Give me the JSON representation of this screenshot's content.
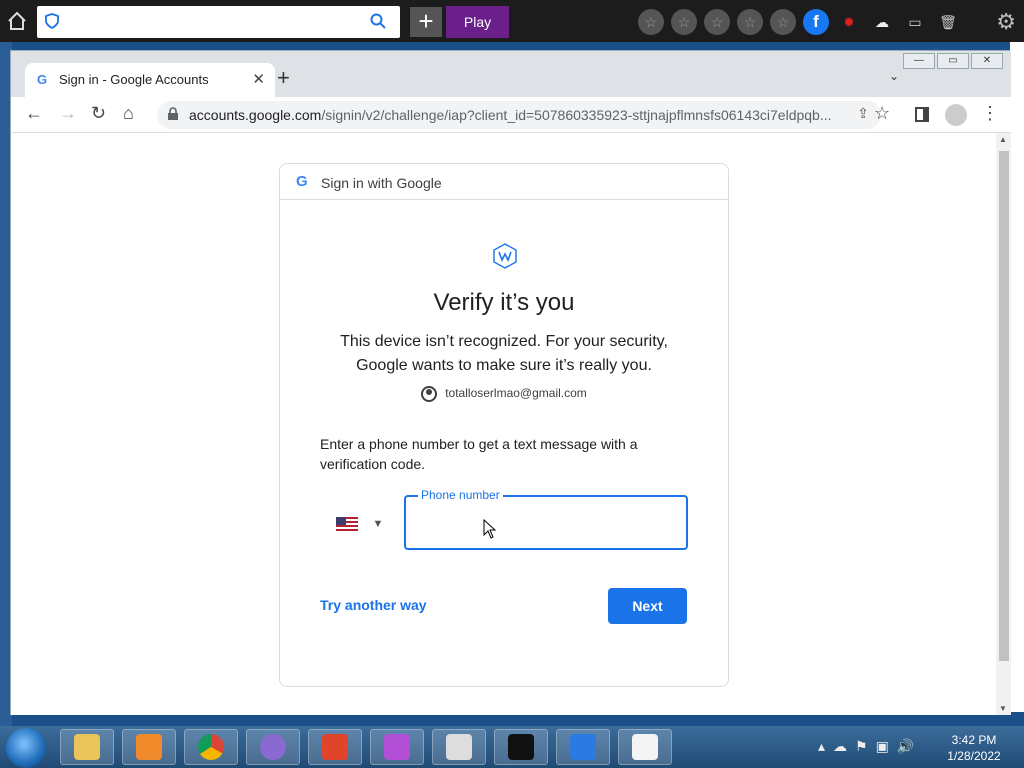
{
  "launcher": {
    "play_label": "Play",
    "plus_label": "+"
  },
  "browser": {
    "tab_title": "Sign in - Google Accounts",
    "url_host": "accounts.google.com",
    "url_path": "/signin/v2/challenge/iap?client_id=507860335923-sttjnajpflmnsfs06143ci7eldpqb..."
  },
  "card": {
    "header": "Sign in with Google",
    "heading": "Verify it’s you",
    "description": "This device isn’t recognized. For your security, Google wants to make sure it’s really you.",
    "account_email": "totalloserlmao@gmail.com",
    "instruction": "Enter a phone number to get a text message with a verification code.",
    "phone_label": "Phone number",
    "phone_value": "",
    "try_another": "Try another way",
    "next": "Next"
  },
  "taskbar": {
    "time": "3:42 PM",
    "date": "1/28/2022"
  },
  "colors": {
    "accent": "#1a73e8",
    "play": "#6a1f8a",
    "facebook": "#1877f2"
  }
}
